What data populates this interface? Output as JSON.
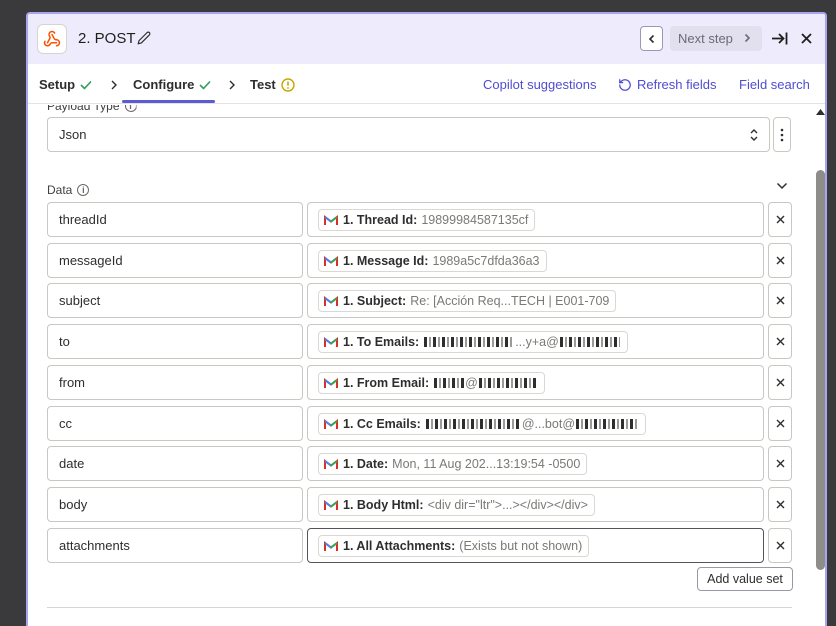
{
  "header": {
    "step_title": "2. POST",
    "next_step_label": "Next step"
  },
  "tabs": [
    {
      "label": "Setup",
      "status": "check"
    },
    {
      "label": "Configure",
      "status": "check"
    },
    {
      "label": "Test",
      "status": "warning"
    }
  ],
  "toolbar": {
    "copilot_label": "Copilot suggestions",
    "refresh_label": "Refresh fields",
    "field_search_label": "Field search"
  },
  "payload": {
    "label": "Payload Type",
    "value": "Json"
  },
  "data_section": {
    "label": "Data",
    "rows": [
      {
        "key": "threadId",
        "field": "1. Thread Id:",
        "value": "19899984587135cf"
      },
      {
        "key": "messageId",
        "field": "1. Message Id:",
        "value": "1989a5c7dfda36a3"
      },
      {
        "key": "subject",
        "field": "1. Subject:",
        "value": "Re: [Acción Req...TECH | E001-709"
      },
      {
        "key": "to",
        "field": "1. To Emails:",
        "value": "...y+a@"
      },
      {
        "key": "from",
        "field": "1. From Email:",
        "value": "@"
      },
      {
        "key": "cc",
        "field": "1. Cc Emails:",
        "value": "@...bot@"
      },
      {
        "key": "date",
        "field": "1. Date:",
        "value": "Mon, 11 Aug 202...13:19:54 -0500"
      },
      {
        "key": "body",
        "field": "1. Body Html:",
        "value": "<div dir=\"ltr\">...></div></div>"
      },
      {
        "key": "attachments",
        "field": "1. All Attachments:",
        "value": "(Exists but not shown)"
      }
    ],
    "add_value_set_label": "Add value set"
  },
  "colors": {
    "accent": "#4f4dd0",
    "success": "#2e9e5b",
    "warning": "#c9a400",
    "header_bg": "#eeecfc"
  }
}
